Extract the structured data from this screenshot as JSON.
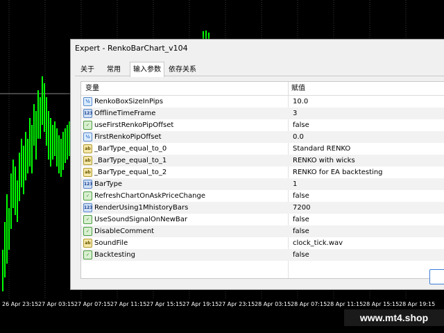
{
  "window": {
    "title": "Expert - RenkoBarChart_v104"
  },
  "tabs": [
    {
      "label": "关于"
    },
    {
      "label": "常用"
    },
    {
      "label": "输入参数"
    },
    {
      "label": "依存关系"
    }
  ],
  "grid": {
    "header_variable": "变量",
    "header_value": "赋值",
    "rows": [
      {
        "type_icon": "double-type-icon",
        "name": "RenkoBoxSizeInPips",
        "value": "10.0"
      },
      {
        "type_icon": "integer-type-icon",
        "name": "OfflineTimeFrame",
        "value": "3"
      },
      {
        "type_icon": "bool-type-icon",
        "name": "useFirstRenkoPipOffset",
        "value": "false"
      },
      {
        "type_icon": "double-type-icon",
        "name": "FirstRenkoPipOffset",
        "value": "0.0"
      },
      {
        "type_icon": "string-type-icon",
        "name": "_BarType_equal_to_0",
        "value": "Standard RENKO"
      },
      {
        "type_icon": "string-type-icon",
        "name": "_BarType_equal_to_1",
        "value": "RENKO with wicks"
      },
      {
        "type_icon": "string-type-icon",
        "name": "_BarType_equal_to_2",
        "value": "RENKO for EA backtesting"
      },
      {
        "type_icon": "integer-type-icon",
        "name": "BarType",
        "value": "1"
      },
      {
        "type_icon": "bool-type-icon",
        "name": "RefreshChartOnAskPriceChange",
        "value": "false"
      },
      {
        "type_icon": "integer-type-icon",
        "name": "RenderUsing1MhistoryBars",
        "value": "7200"
      },
      {
        "type_icon": "bool-type-icon",
        "name": "UseSoundSignalOnNewBar",
        "value": "false"
      },
      {
        "type_icon": "bool-type-icon",
        "name": "DisableComment",
        "value": "false"
      },
      {
        "type_icon": "string-type-icon",
        "name": "SoundFile",
        "value": "clock_tick.wav"
      },
      {
        "type_icon": "bool-type-icon",
        "name": "Backtesting",
        "value": "false"
      }
    ]
  },
  "time_axis": [
    "26 Apr 23:15",
    "27 Apr 03:15",
    "27 Apr 07:15",
    "27 Apr 11:15",
    "27 Apr 15:15",
    "27 Apr 19:15",
    "27 Apr 23:15",
    "28 Apr 03:15",
    "28 Apr 07:15",
    "28 Apr 11:15",
    "28 Apr 15:15",
    "28 Apr 19:15"
  ],
  "watermark": "www.mt4.shop",
  "colors": {
    "candle": "#00ff00",
    "background": "#000000",
    "grid": "#3a3a3a",
    "crosshair": "#8a8a8a"
  }
}
